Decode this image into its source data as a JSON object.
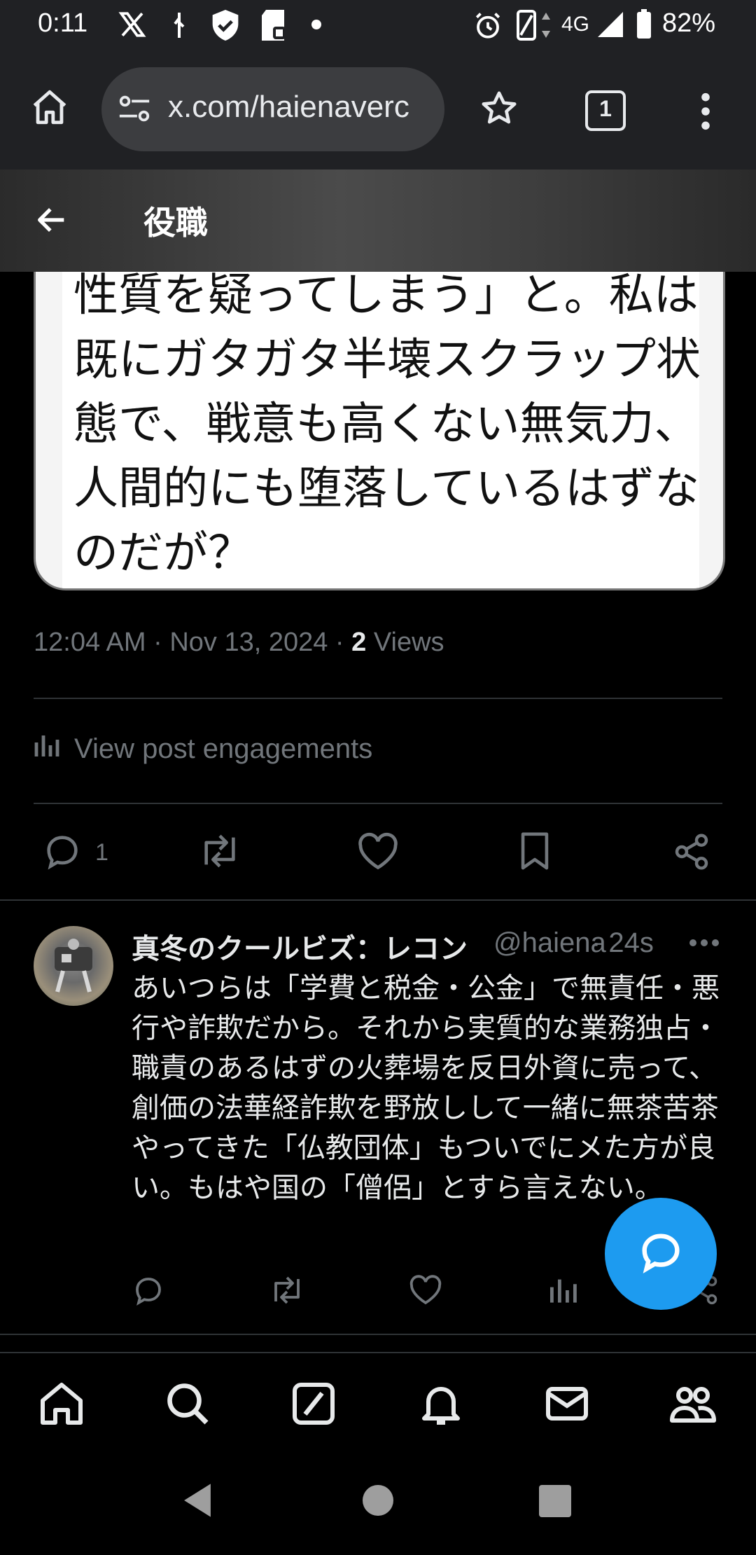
{
  "status_bar": {
    "time": "0:11",
    "network": "4G",
    "battery": "82%",
    "icons": [
      "x-logo-icon",
      "usb-icon",
      "shield-check-icon",
      "sd-card-icon",
      "dot-icon",
      "alarm-icon",
      "vibrate-icon",
      "data-arrows-icon",
      "signal-icon",
      "battery-icon"
    ]
  },
  "browser": {
    "url": "x.com/haienaverc",
    "tab_count": "1"
  },
  "header": {
    "title": "役職"
  },
  "post": {
    "image_text": "性質を疑ってしまう」と。私は既にガタガタ半壊スクラップ状態で、戦意も高くない無気力、人間的にも堕落しているはずなのだが？",
    "timestamp": "12:04 AM · Nov 13, 2024 · ",
    "views_count": "2",
    "views_label": " Views",
    "engagements_label": "View post engagements",
    "reply_count": "1"
  },
  "reply": {
    "display_name": "真冬のクールビズ：レコン",
    "handle": "@haiena",
    "time": "· 24s",
    "text": "あいつらは「学費と税金・公金」で無責任・悪行や詐欺だから。それから実質的な業務独占・職責のあるはずの火葬場を反日外資に売って、創価の法華経詐欺を野放しして一緒に無茶苦茶やってきた「仏教団体」もついでにメた方が良い。もはや国の「僧侶」とすら言えない。"
  },
  "colors": {
    "accent": "#1d9bf0",
    "secondary_text": "#71767b",
    "background": "#000000"
  }
}
